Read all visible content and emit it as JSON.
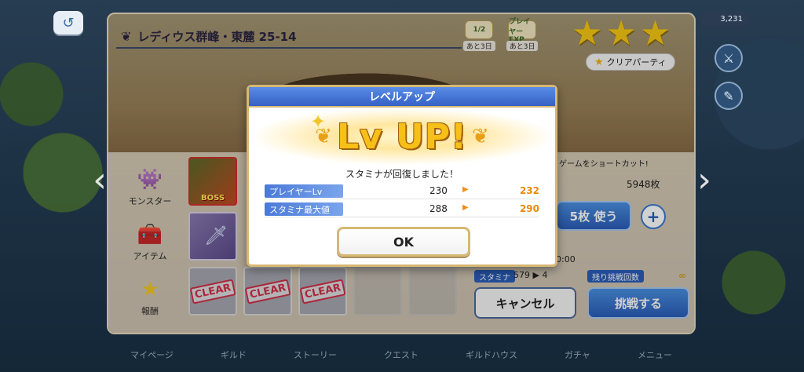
{
  "stage": {
    "title": "レディウス群峰・東麓 25-14",
    "badge_stamina": {
      "icon": "1/2",
      "text": "あと3日"
    },
    "badge_exp": {
      "icon": "プレイヤーEXP",
      "text": "あと3日"
    },
    "clear_party_label": "クリアパーティ"
  },
  "currency": {
    "value": "3,231"
  },
  "categories": [
    {
      "icon": "monster-icon",
      "label": "モンスター"
    },
    {
      "icon": "chest-icon",
      "label": "アイテム"
    },
    {
      "icon": "star-icon",
      "label": "報酬"
    }
  ],
  "tiles": {
    "boss_label": "BOSS",
    "clear_label": "CLEAR"
  },
  "right_panel": {
    "shortcut_text": "ゲームをショートカット!",
    "ticket_count": "5948枚",
    "use_button": "5枚 使う",
    "time_text": "0:00",
    "stamina_label": "スタミナ",
    "stamina_value": "579 ▶ 4",
    "remaining_label": "残り挑戦回数",
    "remaining_value": "∞",
    "cancel_button": "キャンセル",
    "challenge_button": "挑戦する"
  },
  "bottom_nav": [
    "マイページ",
    "ギルド",
    "ストーリー",
    "クエスト",
    "ギルドハウス",
    "ガチャ",
    "メニュー"
  ],
  "modal": {
    "header": "レベルアップ",
    "banner_text": "Lv UP!",
    "recover_message": "スタミナが回復しました！",
    "rows": [
      {
        "label": "プレイヤーLv",
        "before": "230",
        "after": "232"
      },
      {
        "label": "スタミナ最大値",
        "before": "288",
        "after": "290"
      }
    ],
    "ok_button": "OK"
  },
  "colors": {
    "accent_blue": "#3561c4",
    "gold_border": "#d6b874",
    "lvup_gold": "#f7c018",
    "after_value_orange": "#e88a10"
  }
}
